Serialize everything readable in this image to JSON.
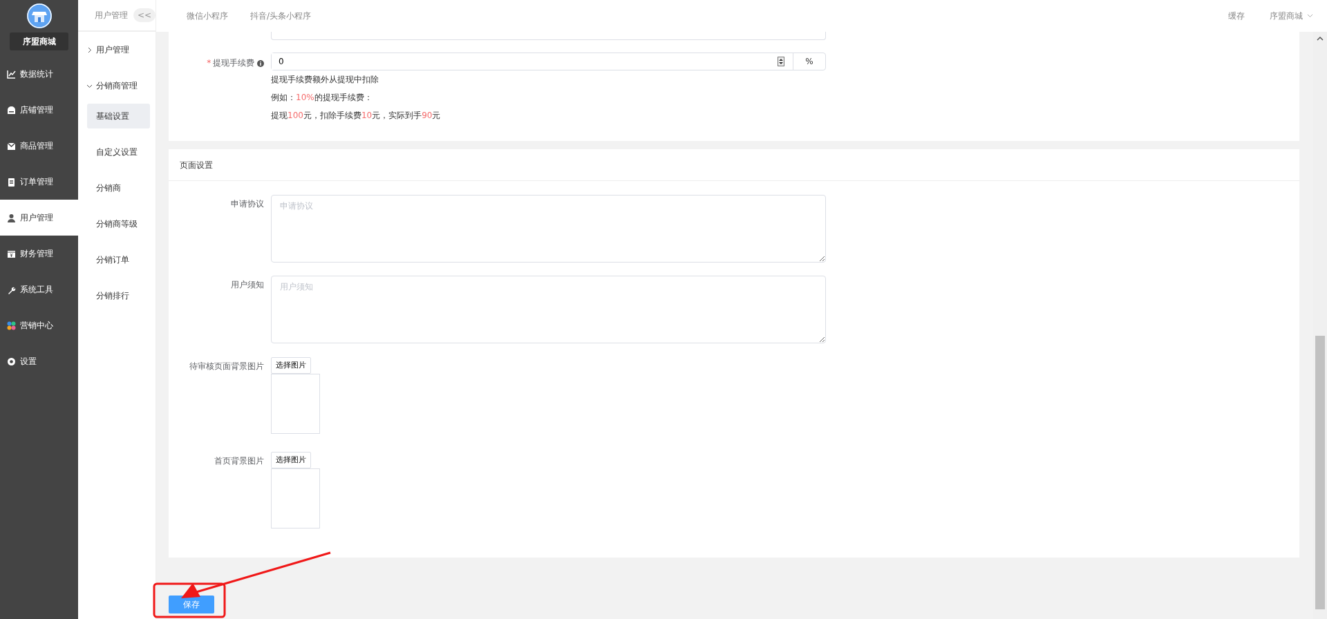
{
  "sidebar": {
    "store_name": "序盟商城",
    "items": [
      {
        "label": "数据统计",
        "selected": false
      },
      {
        "label": "店铺管理",
        "selected": false
      },
      {
        "label": "商品管理",
        "selected": false
      },
      {
        "label": "订单管理",
        "selected": false
      },
      {
        "label": "用户管理",
        "selected": true
      },
      {
        "label": "财务管理",
        "selected": false
      },
      {
        "label": "系统工具",
        "selected": false
      },
      {
        "label": "营销中心",
        "selected": false
      },
      {
        "label": "设置",
        "selected": false
      }
    ]
  },
  "submenu": {
    "title": "用户管理",
    "collapse": "<<",
    "groups": [
      {
        "label": "用户管理",
        "expanded": false
      },
      {
        "label": "分销商管理",
        "expanded": true,
        "children": [
          {
            "label": "基础设置",
            "selected": true
          },
          {
            "label": "自定义设置",
            "selected": false
          },
          {
            "label": "分销商",
            "selected": false
          },
          {
            "label": "分销商等级",
            "selected": false
          },
          {
            "label": "分销订单",
            "selected": false
          },
          {
            "label": "分销排行",
            "selected": false
          }
        ]
      }
    ]
  },
  "topbar": {
    "tabs": [
      {
        "label": "微信小程序"
      },
      {
        "label": "抖音/头条小程序"
      }
    ],
    "actions": [
      {
        "label": "缓存",
        "dropdown": false
      },
      {
        "label": "序盟商城",
        "dropdown": true
      }
    ]
  },
  "fee_section": {
    "field": {
      "required_mark": "*",
      "label": "提现手续费",
      "value": "0",
      "unit": "%"
    },
    "notes": [
      [
        {
          "text": "提现手续费额外从提现中扣除",
          "highlight": false
        }
      ],
      [
        {
          "text": "例如：",
          "highlight": false
        },
        {
          "text": "10%",
          "highlight": true
        },
        {
          "text": "的提现手续费：",
          "highlight": false
        }
      ],
      [
        {
          "text": "提现",
          "highlight": false
        },
        {
          "text": "100",
          "highlight": true
        },
        {
          "text": "元，扣除手续费",
          "highlight": false
        },
        {
          "text": "10",
          "highlight": true
        },
        {
          "text": "元，实际到手",
          "highlight": false
        },
        {
          "text": "90",
          "highlight": true
        },
        {
          "text": "元",
          "highlight": false
        }
      ]
    ]
  },
  "page_section": {
    "title": "页面设置",
    "fields": [
      {
        "kind": "textarea",
        "label": "申请协议",
        "placeholder": "申请协议"
      },
      {
        "kind": "textarea",
        "label": "用户须知",
        "placeholder": "用户须知"
      },
      {
        "kind": "image",
        "label": "待审核页面背景图片",
        "button": "选择图片"
      },
      {
        "kind": "image",
        "label": "首页背景图片",
        "button": "选择图片"
      }
    ]
  },
  "save_button": "保存",
  "annotations": [
    {
      "kind": "highlight-box"
    },
    {
      "kind": "arrow"
    }
  ]
}
